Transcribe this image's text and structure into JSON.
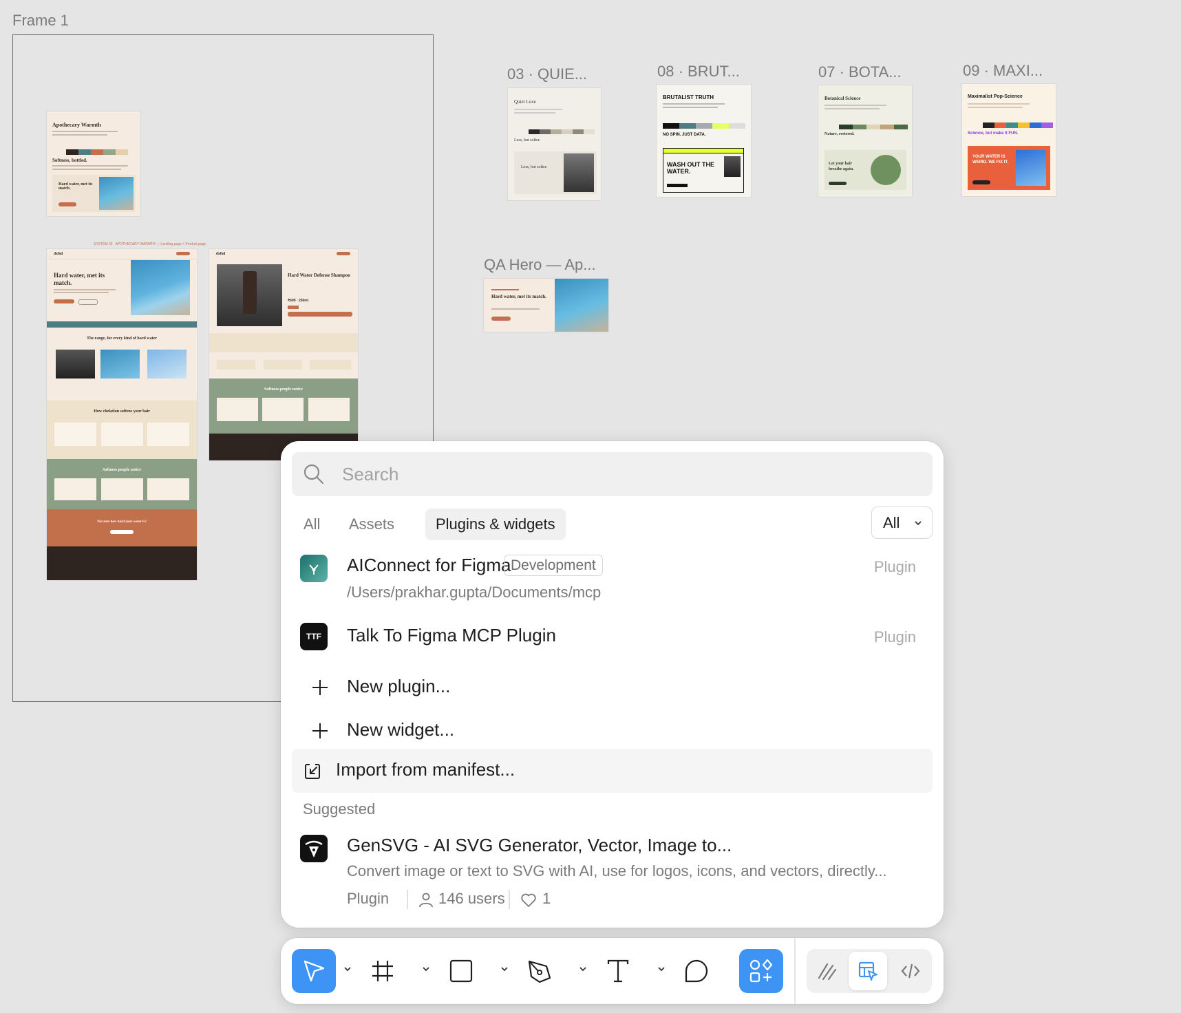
{
  "canvas": {
    "frame_label": "Frame 1",
    "thumbnails": [
      {
        "label": "03 · QUIE..."
      },
      {
        "label": "08 · BRUT..."
      },
      {
        "label": "07 · BOTA..."
      },
      {
        "label": "09 · MAXI..."
      },
      {
        "label": "QA Hero — Ap..."
      }
    ],
    "apothecary_card": {
      "title": "Apothecary Warmth",
      "headline": "Softness, bottled.",
      "hero": "Hard water, met its match."
    },
    "landing_page": {
      "headline": "Hard water, met its match.",
      "range_heading": "The range, for every kind of hard water",
      "chelation_heading": "How chelation softens your hair",
      "reviews_heading": "Softness people notice",
      "cta_heading": "Not sure how hard your water is?"
    },
    "product_page": {
      "title": "Hard Water Defense Shampoo",
      "price": "₹699 · 250ml",
      "reviews_heading": "Softness people notice"
    },
    "quiet_luxe": {
      "title": "Quiet Luxe",
      "headline": "Less, but softer."
    },
    "brutalist": {
      "title": "BRUTALIST TRUTH",
      "sub": "NO SPIN. JUST DATA.",
      "hero": "WASH OUT THE WATER."
    },
    "botanical": {
      "title": "Botanical Science",
      "headline": "Nature, restored.",
      "hero": "Let your hair breathe again."
    },
    "maximalist": {
      "title": "Maximalist Pop-Science",
      "sub": "Science, but make it FUN.",
      "hero": "YOUR WATER IS WEIRD. WE FIX IT."
    },
    "qa_hero": {
      "headline": "Hard water, met its match."
    }
  },
  "panel": {
    "search": {
      "placeholder": "Search"
    },
    "tabs": [
      {
        "label": "All"
      },
      {
        "label": "Assets"
      },
      {
        "label": "Plugins & widgets"
      }
    ],
    "filter": {
      "value": "All"
    },
    "items": [
      {
        "title": "AIConnect for Figma",
        "badge": "Development",
        "path": "/Users/prakhar.gupta/Documents/mcp",
        "kind": "Plugin",
        "icon": "aiconnect-icon"
      },
      {
        "title": "Talk To Figma MCP Plugin",
        "kind": "Plugin",
        "icon_text": "TTF"
      }
    ],
    "actions": [
      {
        "label": "New plugin...",
        "icon": "plus-icon"
      },
      {
        "label": "New widget...",
        "icon": "plus-icon"
      },
      {
        "label": "Import from manifest...",
        "icon": "import-icon"
      }
    ],
    "suggested_heading": "Suggested",
    "suggested": {
      "title": "GenSVG - AI SVG Generator, Vector, Image to...",
      "description": "Convert image or text to SVG with AI, use for logos, icons, and vectors, directly...",
      "kind": "Plugin",
      "users": "146 users",
      "likes": "1"
    }
  },
  "toolbar": {
    "tools": [
      "move-tool",
      "frame-tool",
      "shape-tool",
      "pen-tool",
      "text-tool",
      "comment-tool",
      "actions-tool"
    ],
    "modes": [
      "draw-mode",
      "design-mode",
      "dev-mode"
    ],
    "accent": "#3d94f5"
  }
}
